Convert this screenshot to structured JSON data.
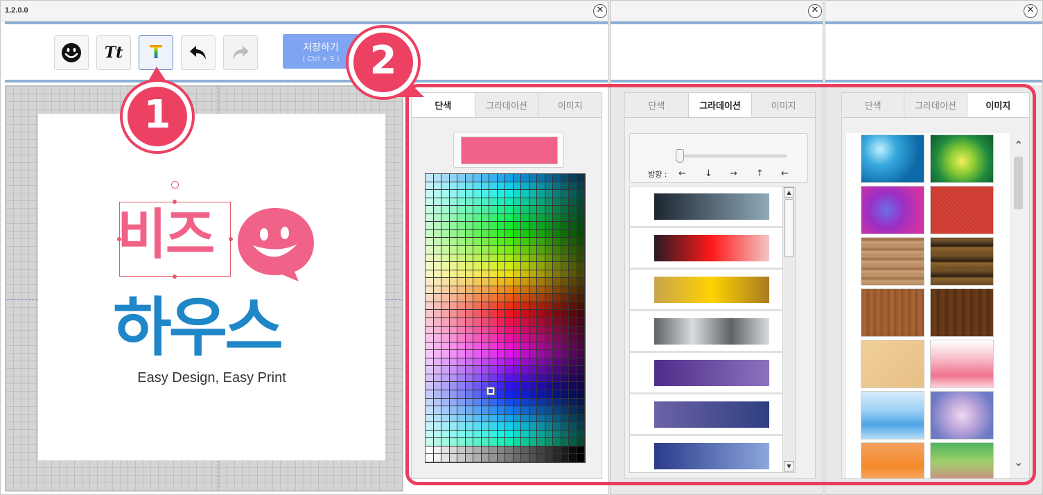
{
  "app": {
    "version": "1.2.0.0",
    "close_glyph": "✕"
  },
  "toolbar": {
    "buttons": [
      {
        "name": "emoji-button",
        "icon": "smiley-icon"
      },
      {
        "name": "text-style-button",
        "icon": "text-style-icon"
      },
      {
        "name": "text-color-button",
        "icon": "rainbow-text-icon"
      },
      {
        "name": "undo-button",
        "icon": "undo-icon"
      },
      {
        "name": "redo-button",
        "icon": "redo-icon"
      }
    ],
    "text_style_glyph": "Tt",
    "text_color_glyph": "T",
    "save_label": "저장하기",
    "save_shortcut": "( Ctrl + S )"
  },
  "canvas": {
    "logo_top": "비즈",
    "logo_bottom": "하우스",
    "tagline": "Easy Design, Easy Print",
    "brand_colors": {
      "pink": "#f06287",
      "blue": "#1f86c8"
    }
  },
  "callouts": {
    "one": "1",
    "two": "2",
    "color": "#ec4163"
  },
  "tabs": {
    "solid": "단색",
    "gradient": "그라데이션",
    "image": "이미지"
  },
  "solid_panel": {
    "current_color": "#f06287"
  },
  "gradient_panel": {
    "direction_label": "방향 :",
    "directions": [
      "←",
      "↓",
      "→",
      "↑",
      "←"
    ],
    "gradients": [
      [
        "#1c2530",
        "#8fa9b9"
      ],
      [
        "#2a1a22",
        "#ff1a1a",
        "#f2c6c6"
      ],
      [
        "#c7a54d",
        "#ffd200",
        "#a67b1f"
      ],
      [
        "#5d6266",
        "#d9dde0",
        "#5d6266",
        "#d9dde0"
      ],
      [
        "#4d2d8a",
        "#8b73bd"
      ],
      [
        "#6c62a8",
        "#2e3f7f"
      ],
      [
        "#2a3a8a",
        "#8da7dd"
      ]
    ]
  },
  "image_panel": {
    "textures": [
      "water",
      "green-watercolor",
      "purple-watercolor",
      "red-fabric",
      "light-wood",
      "dark-wood-planks",
      "brown-wood",
      "dark-brown-wood",
      "beige-paper",
      "pink-watercolor",
      "blue-watercolor",
      "purple-blue-watercolor",
      "orange-paint",
      "green-pink-watercolor"
    ],
    "scroll_up": "⌃",
    "scroll_down": "⌄"
  }
}
